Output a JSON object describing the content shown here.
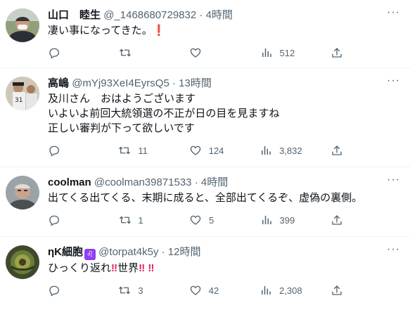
{
  "tweets": [
    {
      "name": "山口　睦生",
      "handle": "@_1468680729832",
      "time": "4時間",
      "text": "凄い事になってきた。",
      "emoji_suffix": "❗",
      "reply_count": "",
      "retweet_count": "",
      "like_count": "",
      "view_count": "512"
    },
    {
      "name": "高嶋",
      "handle": "@mYj93XeI4EyrsQ5",
      "time": "13時間",
      "text": "及川さん　おはようございます\nいよいよ前回大統領選の不正が日の目を見ますね\n正しい審判が下って欲しいです",
      "emoji_suffix": "",
      "reply_count": "",
      "retweet_count": "11",
      "like_count": "124",
      "view_count": "3,832"
    },
    {
      "name": "coolman",
      "handle": "@coolman39871533",
      "time": "4時間",
      "text": "出てくる出てくる、末期に成ると、全部出てくるぞ、虚偽の裏側。",
      "emoji_suffix": "",
      "reply_count": "",
      "retweet_count": "1",
      "like_count": "5",
      "view_count": "399"
    },
    {
      "name": "ηK細胞",
      "badge": "♌",
      "handle": "@torpat4k5y",
      "time": "12時間",
      "text": "ひっくり返れ",
      "text_parts": [
        "ひっくり返れ",
        "‼",
        "世界",
        "‼",
        "‼"
      ],
      "emoji_suffix": "",
      "reply_count": "",
      "retweet_count": "3",
      "like_count": "42",
      "view_count": "2,308"
    }
  ],
  "dot_separator": "·",
  "more_label": "···",
  "icons": {
    "reply": "reply-icon",
    "retweet": "retweet-icon",
    "like": "heart-icon",
    "views": "views-icon",
    "share": "share-icon",
    "more": "more-icon"
  },
  "colors": {
    "text": "#0f1419",
    "secondary": "#536471",
    "emoji": "#e0245e",
    "divider": "#eff3f4"
  }
}
